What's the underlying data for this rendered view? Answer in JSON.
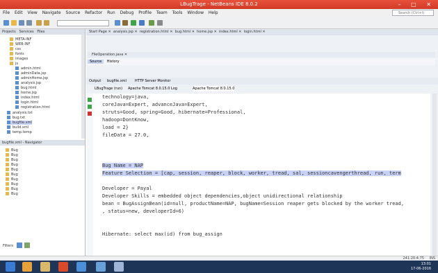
{
  "window": {
    "title": "LBugTrage - NetBeans IDE 8.0.2"
  },
  "menu": [
    "File",
    "Edit",
    "View",
    "Navigate",
    "Source",
    "Refactor",
    "Run",
    "Debug",
    "Profile",
    "Team",
    "Tools",
    "Window",
    "Help"
  ],
  "search": {
    "placeholder": "Search (Ctrl+I)"
  },
  "left_panel": {
    "tabs": [
      "Projects",
      "Services",
      "Files"
    ],
    "tree": [
      "META-INF",
      "WEB-INF",
      "css",
      "fonts",
      "images",
      "js",
      "admin.html",
      "adminData.jsp",
      "adminHome.jsp",
      "analysis.jsp",
      "bug.html",
      "home.jsp",
      "index.html",
      "login.html",
      "registration.html",
      "analysis.txt",
      "bug.txt",
      "bugfile.xml",
      "build.xml",
      "temp.temp"
    ],
    "navigator_title": "bugfile.xml - Navigator",
    "navigator_items": [
      "Bug",
      "Bug",
      "Bug",
      "Bug",
      "Bug",
      "Bug",
      "Bug",
      "Bug",
      "Bug",
      "Bug"
    ],
    "filters_label": "Filters"
  },
  "editor": {
    "doc_tabs": [
      "Start Page",
      "analysis.jsp",
      "registration.html",
      "bug.html",
      "home.jsp",
      "index.html",
      "login.html"
    ],
    "inner_file": "FileOperation.java",
    "inner_toolbar": [
      "Source",
      "History"
    ],
    "output_tabs": [
      "Output",
      "bugfile.xml",
      "HTTP Server Monitor"
    ],
    "console_tabs": [
      "LBugTrage (run)",
      "Apache Tomcat 8.0.15.0 Log",
      "Apache Tomcat 8.0.15.0"
    ],
    "lines": [
      "technology=java,",
      "coreJava=Expert, advanceJava=Expert,",
      "struts=Good, spring=Good, hibernate=Professional,",
      "hadoop=DontKnow,",
      "load = 2}",
      "fileData = 27.0,",
      "",
      "",
      "",
      "Bug Name = NAP",
      "Feature Selection = [cap, session, reaper, block, worker, tread, sal, sessioncavengerthread, run, term",
      "",
      "Developer = Payal",
      "Developer Skills = embedded object dependencies,object unidirectional relationship",
      "bean = BugAssignBean(id=null, productName=NAP, bugName=Session reaper gets blocked by the worker tread,",
      ", status=new, developerId=6)",
      "",
      "",
      "Hibernate: select max(id) from bug_assign"
    ]
  },
  "status": {
    "position": "241:20:4:75",
    "mode": "INS"
  },
  "taskbar": {
    "time": "13:01",
    "date": "17-06-2016"
  }
}
